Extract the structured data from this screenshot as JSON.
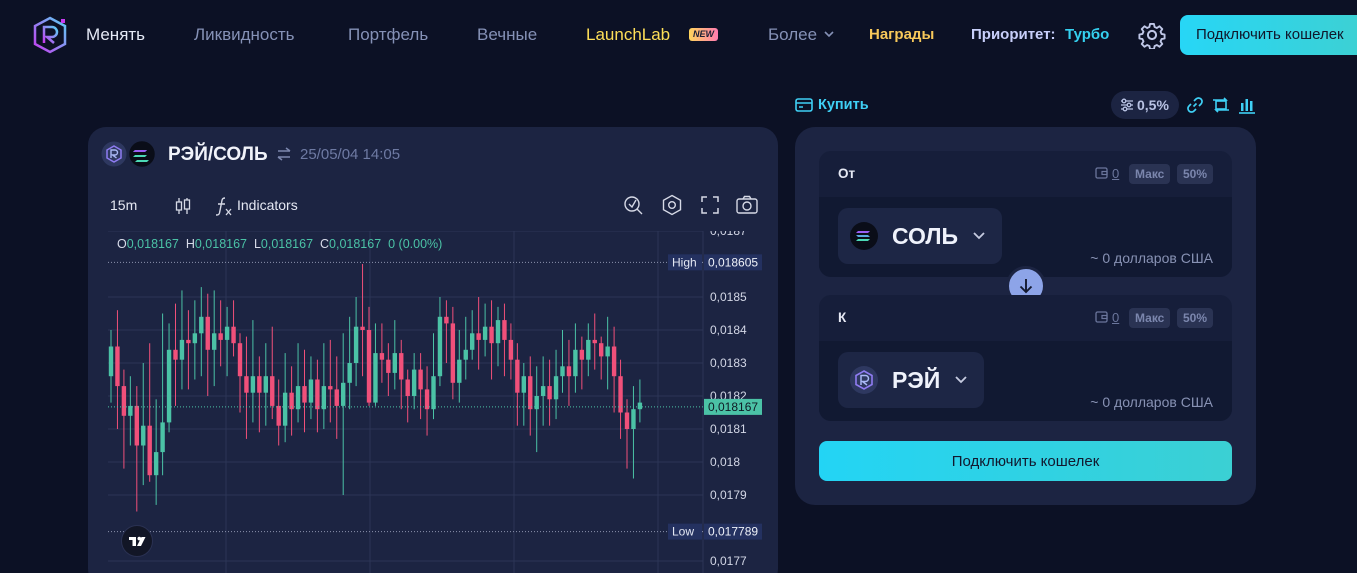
{
  "nav": {
    "items": [
      "Менять",
      "Ликвидность",
      "Портфель",
      "Вечные",
      "LaunchLab",
      "Более"
    ],
    "new_badge": "NEW",
    "rewards": "Награды",
    "priority_label": "Приоритет:",
    "priority_value": "Турбо",
    "connect_wallet": "Подключить кошелек"
  },
  "icons": {
    "logo": "raydium-logo",
    "settings": "gear-icon",
    "more": "chevron-down-icon"
  },
  "chart_panel": {
    "pair": "РЭЙ/СОЛЬ",
    "timestamp": "25/05/04 14:05",
    "interval": "15m",
    "indicators": "Indicators",
    "ohlc": {
      "o_label": "O",
      "o": "0,018167",
      "h_label": "H",
      "h": "0,018167",
      "l_label": "L",
      "l": "0,018167",
      "c_label": "C",
      "c": "0,018167",
      "change": "0 (0.00%)"
    }
  },
  "chart_data": {
    "type": "candlestick",
    "title": "",
    "interval": "15m",
    "y_ticks": [
      "0,0187",
      "0,0185",
      "0,0184",
      "0,0183",
      "0,0182",
      "0,0181",
      "0,018",
      "0,0179",
      "0,0177"
    ],
    "ylim": [
      0.0177,
      0.01871
    ],
    "high_label": "High",
    "high_value": "0,018605",
    "low_label": "Low",
    "low_value": "0,017789",
    "last_value": "0,018167",
    "up_color": "#4bc2a6",
    "down_color": "#f0507a",
    "candles": [
      [
        0.01826,
        0.01835,
        0.0184,
        0.01818
      ],
      [
        0.01835,
        0.01823,
        0.01846,
        0.0181
      ],
      [
        0.01823,
        0.01814,
        0.01828,
        0.01798
      ],
      [
        0.01814,
        0.01817,
        0.01826,
        0.01805
      ],
      [
        0.01817,
        0.01805,
        0.01823,
        0.01785
      ],
      [
        0.01805,
        0.01811,
        0.0183,
        0.01793
      ],
      [
        0.01811,
        0.01796,
        0.01836,
        0.01794
      ],
      [
        0.01796,
        0.01803,
        0.01819,
        0.01787
      ],
      [
        0.01803,
        0.01812,
        0.01845,
        0.01796
      ],
      [
        0.01812,
        0.01834,
        0.01842,
        0.01809
      ],
      [
        0.01834,
        0.01831,
        0.01848,
        0.01817
      ],
      [
        0.01831,
        0.01837,
        0.01852,
        0.01822
      ],
      [
        0.01837,
        0.01836,
        0.01846,
        0.01822
      ],
      [
        0.01836,
        0.01839,
        0.01849,
        0.01825
      ],
      [
        0.01839,
        0.01844,
        0.01853,
        0.01826
      ],
      [
        0.01844,
        0.01834,
        0.01851,
        0.0182
      ],
      [
        0.01834,
        0.01839,
        0.01852,
        0.01823
      ],
      [
        0.01839,
        0.01837,
        0.01849,
        0.01829
      ],
      [
        0.01837,
        0.01841,
        0.01847,
        0.01826
      ],
      [
        0.01841,
        0.01836,
        0.01849,
        0.01832
      ],
      [
        0.01836,
        0.01826,
        0.01839,
        0.01815
      ],
      [
        0.01826,
        0.01821,
        0.01838,
        0.01807
      ],
      [
        0.01821,
        0.01826,
        0.01843,
        0.01812
      ],
      [
        0.01826,
        0.01821,
        0.01832,
        0.01809
      ],
      [
        0.01821,
        0.01826,
        0.01836,
        0.01811
      ],
      [
        0.01826,
        0.01817,
        0.01841,
        0.01813
      ],
      [
        0.01817,
        0.01811,
        0.01825,
        0.01805
      ],
      [
        0.01811,
        0.01821,
        0.01833,
        0.01806
      ],
      [
        0.01821,
        0.01816,
        0.01829,
        0.01808
      ],
      [
        0.01816,
        0.01823,
        0.01836,
        0.01812
      ],
      [
        0.01823,
        0.01818,
        0.01834,
        0.01809
      ],
      [
        0.01818,
        0.01825,
        0.01832,
        0.01813
      ],
      [
        0.01825,
        0.01816,
        0.01831,
        0.01809
      ],
      [
        0.01816,
        0.01823,
        0.01836,
        0.0181
      ],
      [
        0.01823,
        0.01822,
        0.01837,
        0.01812
      ],
      [
        0.01822,
        0.01817,
        0.01832,
        0.01807
      ],
      [
        0.01817,
        0.01824,
        0.01839,
        0.0179
      ],
      [
        0.01824,
        0.0183,
        0.01844,
        0.01816
      ],
      [
        0.0183,
        0.01841,
        0.0185,
        0.01823
      ],
      [
        0.01841,
        0.0184,
        0.0186,
        0.01826
      ],
      [
        0.0184,
        0.01818,
        0.01847,
        0.01817
      ],
      [
        0.01818,
        0.01833,
        0.01842,
        0.01817
      ],
      [
        0.01833,
        0.01831,
        0.01842,
        0.01824
      ],
      [
        0.01831,
        0.01827,
        0.01836,
        0.0182
      ],
      [
        0.01827,
        0.01833,
        0.01843,
        0.01822
      ],
      [
        0.01833,
        0.01825,
        0.01837,
        0.01816
      ],
      [
        0.01825,
        0.0182,
        0.01828,
        0.01812
      ],
      [
        0.0182,
        0.01828,
        0.01833,
        0.01816
      ],
      [
        0.01828,
        0.01822,
        0.01833,
        0.01813
      ],
      [
        0.01822,
        0.01816,
        0.01829,
        0.01808
      ],
      [
        0.01816,
        0.01826,
        0.01839,
        0.01813
      ],
      [
        0.01826,
        0.01844,
        0.0185,
        0.01823
      ],
      [
        0.01844,
        0.01842,
        0.01849,
        0.0183
      ],
      [
        0.01842,
        0.01824,
        0.01847,
        0.01819
      ],
      [
        0.01824,
        0.01831,
        0.0184,
        0.01818
      ],
      [
        0.01831,
        0.01834,
        0.01844,
        0.01825
      ],
      [
        0.01834,
        0.01839,
        0.01846,
        0.01831
      ],
      [
        0.01839,
        0.01837,
        0.0185,
        0.01828
      ],
      [
        0.01837,
        0.01841,
        0.01848,
        0.01832
      ],
      [
        0.01841,
        0.01836,
        0.01849,
        0.01825
      ],
      [
        0.01836,
        0.01843,
        0.01847,
        0.01829
      ],
      [
        0.01843,
        0.01837,
        0.01848,
        0.01826
      ],
      [
        0.01837,
        0.01831,
        0.01842,
        0.01825
      ],
      [
        0.01831,
        0.01821,
        0.01836,
        0.01811
      ],
      [
        0.01821,
        0.01826,
        0.0183,
        0.01811
      ],
      [
        0.01826,
        0.01816,
        0.01832,
        0.01808
      ],
      [
        0.01816,
        0.0182,
        0.01829,
        0.01803
      ],
      [
        0.0182,
        0.01823,
        0.01832,
        0.01811
      ],
      [
        0.01823,
        0.01819,
        0.01831,
        0.01811
      ],
      [
        0.01819,
        0.01826,
        0.01834,
        0.01813
      ],
      [
        0.01826,
        0.01829,
        0.0184,
        0.01821
      ],
      [
        0.01829,
        0.01826,
        0.01837,
        0.01817
      ],
      [
        0.01826,
        0.01834,
        0.01842,
        0.01821
      ],
      [
        0.01834,
        0.01831,
        0.01838,
        0.01822
      ],
      [
        0.01831,
        0.01837,
        0.01842,
        0.01826
      ],
      [
        0.01837,
        0.01836,
        0.01845,
        0.01828
      ],
      [
        0.01836,
        0.01832,
        0.01838,
        0.01825
      ],
      [
        0.01832,
        0.01835,
        0.01844,
        0.01822
      ],
      [
        0.01835,
        0.01826,
        0.01841,
        0.01815
      ],
      [
        0.01826,
        0.01815,
        0.01831,
        0.01807
      ],
      [
        0.01815,
        0.0181,
        0.01819,
        0.01798
      ],
      [
        0.0181,
        0.01816,
        0.01823,
        0.01795
      ],
      [
        0.01816,
        0.01818,
        0.01825,
        0.01812
      ]
    ]
  },
  "swap": {
    "buy": "Купить",
    "slippage": "0,5%",
    "from_label": "От",
    "to_label": "К",
    "balance": "0",
    "max": "Макс",
    "half": "50%",
    "from_token": "СОЛЬ",
    "to_token": "РЭЙ",
    "usd_value": "~ 0 долларов США",
    "connect_wallet": "Подключить кошелек"
  }
}
